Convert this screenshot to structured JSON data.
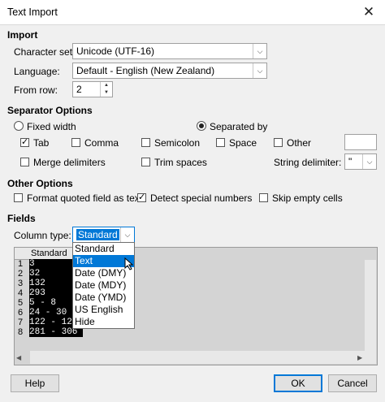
{
  "window": {
    "title": "Text Import",
    "close_glyph": "✕"
  },
  "import": {
    "heading": "Import",
    "charset_label": "Character set:",
    "charset_value": "Unicode (UTF-16)",
    "language_label": "Language:",
    "language_value": "Default - English (New Zealand)",
    "from_row_label": "From row:",
    "from_row_value": "2"
  },
  "separator": {
    "heading": "Separator Options",
    "fixed_width": "Fixed width",
    "separated_by": "Separated by",
    "tab": "Tab",
    "comma": "Comma",
    "semicolon": "Semicolon",
    "space": "Space",
    "other": "Other",
    "other_value": "",
    "merge": "Merge delimiters",
    "trim": "Trim spaces",
    "string_delim_label": "String delimiter:",
    "string_delim_value": "\""
  },
  "other_options": {
    "heading": "Other Options",
    "format_quoted": "Format quoted field as text",
    "detect_special": "Detect special numbers",
    "skip_empty": "Skip empty cells"
  },
  "fields": {
    "heading": "Fields",
    "column_type_label": "Column type:",
    "column_type_value": "Standard",
    "dropdown_options": [
      "Standard",
      "Text",
      "Date (DMY)",
      "Date (MDY)",
      "Date (YMD)",
      "US English",
      "Hide"
    ],
    "grid_header": "Standard",
    "rows": [
      {
        "num": "1",
        "value": "3"
      },
      {
        "num": "2",
        "value": "32"
      },
      {
        "num": "3",
        "value": "132"
      },
      {
        "num": "4",
        "value": "293"
      },
      {
        "num": "5",
        "value": "5 - 8"
      },
      {
        "num": "6",
        "value": "24 - 30"
      },
      {
        "num": "7",
        "value": "122 - 12"
      },
      {
        "num": "8",
        "value": "281 - 306"
      }
    ]
  },
  "buttons": {
    "help": "Help",
    "ok": "OK",
    "cancel": "Cancel"
  },
  "colors": {
    "accent": "#0078d7",
    "grid_bg": "#d4d4d4",
    "cell_bg": "#000000"
  }
}
